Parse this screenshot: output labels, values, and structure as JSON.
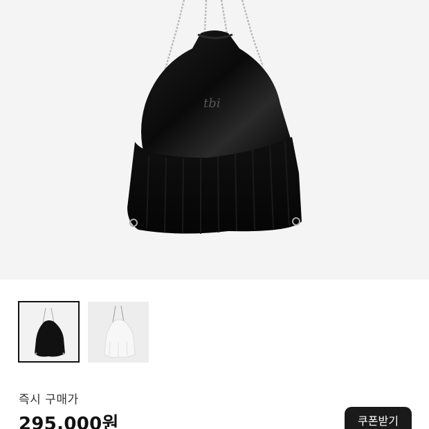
{
  "product": {
    "hero_image": "black-velvet-drawstring-bag-with-silver-chains",
    "bag_logo_text": "tbi",
    "thumbnails": [
      {
        "image": "black-bag-thumbnail",
        "selected": true
      },
      {
        "image": "white-bag-thumbnail",
        "selected": false
      }
    ],
    "price_label": "즉시 구매가",
    "price": "295,000원",
    "coupon_label": "쿠폰받기"
  },
  "colors": {
    "hero_bg": "#f4f4f4",
    "bag": "#111111",
    "chain": "#b8b8b8",
    "button_bg": "#1a1a1a"
  }
}
